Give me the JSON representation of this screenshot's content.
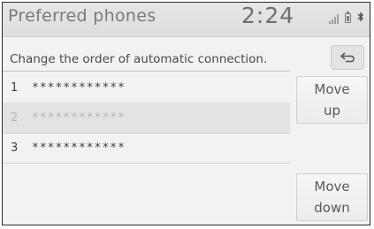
{
  "header": {
    "title": "Preferred phones",
    "clock": "2:24",
    "status_icons": [
      "signal-icon",
      "battery-icon",
      "bluetooth-icon"
    ],
    "bluetooth_glyph": "ʙ"
  },
  "instruction": "Change the order of automatic connection.",
  "back_button": {
    "icon": "back-arrow-icon"
  },
  "phones": [
    {
      "index": "1",
      "name": "************",
      "state": "normal"
    },
    {
      "index": "2",
      "name": "************",
      "state": "selected"
    },
    {
      "index": "3",
      "name": "************",
      "state": "normal"
    }
  ],
  "buttons": {
    "move_up": {
      "line1": "Move",
      "line2": "up"
    },
    "move_down": {
      "line1": "Move",
      "line2": "down"
    }
  },
  "colors": {
    "header_bg": "#e3e3e3",
    "screen_bg": "#f2f2f2",
    "selected_row_bg": "#e3e3e3",
    "text": "#4a4a4a",
    "dimmed_text": "#b4b4b4"
  }
}
